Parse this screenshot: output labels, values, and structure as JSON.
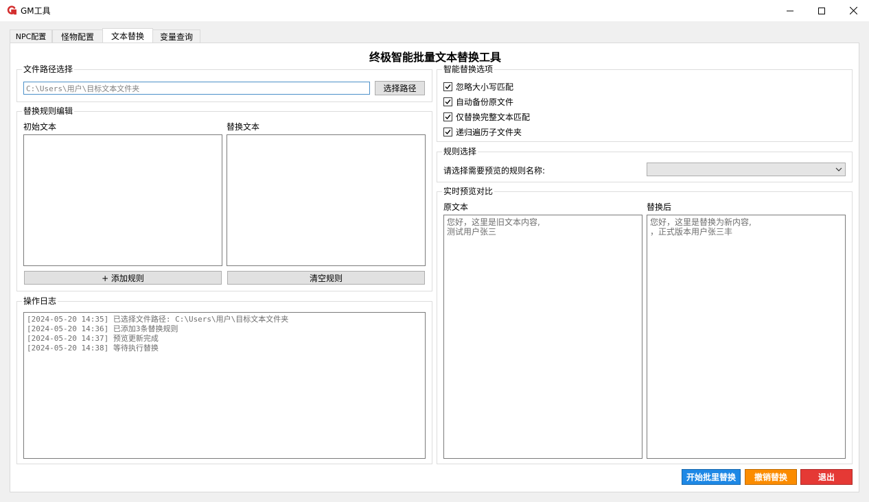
{
  "window": {
    "title": "GM工具"
  },
  "tabs": [
    {
      "label": "NPC配置"
    },
    {
      "label": "怪物配置"
    },
    {
      "label": "文本替换"
    },
    {
      "label": "变量查询"
    }
  ],
  "active_tab": "文本替换",
  "main": {
    "title": "终极智能批量文本替换工具",
    "file_path": {
      "group_title": "文件路径选择",
      "path_value": "C:\\Users\\用户\\目标文本文件夹",
      "select_button": "选择路径"
    },
    "rules_edit": {
      "group_title": "替换规则编辑",
      "original_label": "初始文本",
      "replace_label": "替换文本",
      "add_button": "+ 添加规则",
      "clear_button": "清空规则"
    },
    "log": {
      "group_title": "操作日志",
      "lines": [
        "[2024-05-20 14:35] 已选择文件路径: C:\\Users\\用户\\目标文本文件夹",
        "[2024-05-20 14:36] 已添加3条替换规则",
        "[2024-05-20 14:37] 预览更新完成",
        "[2024-05-20 14:38] 等待执行替换"
      ]
    },
    "options": {
      "group_title": "智能替换选项",
      "items": [
        {
          "label": "忽略大小写匹配",
          "checked": true
        },
        {
          "label": "自动备份原文件",
          "checked": true
        },
        {
          "label": "仅替换完整文本匹配",
          "checked": true
        },
        {
          "label": "递归遍历子文件夹",
          "checked": true
        }
      ]
    },
    "rule_select": {
      "group_title": "规则选择",
      "prompt": "请选择需要预览的规则名称:",
      "selected": ""
    },
    "preview": {
      "group_title": "实时预览对比",
      "original_label": "原文本",
      "replaced_label": "替换后",
      "original_lines": [
        "您好，这里是旧文本内容,",
        "测试用户张三"
      ],
      "replaced_lines": [
        "您好，这里是替换为新内容,",
        "，正式版本用户张三丰"
      ]
    },
    "actions": {
      "start": "开始批里替换",
      "undo": "撤销替换",
      "exit": "退出"
    }
  },
  "colors": {
    "start": "#1e88e5",
    "undo": "#fb8c00",
    "exit": "#e53935",
    "logo": "#d32f2f"
  }
}
